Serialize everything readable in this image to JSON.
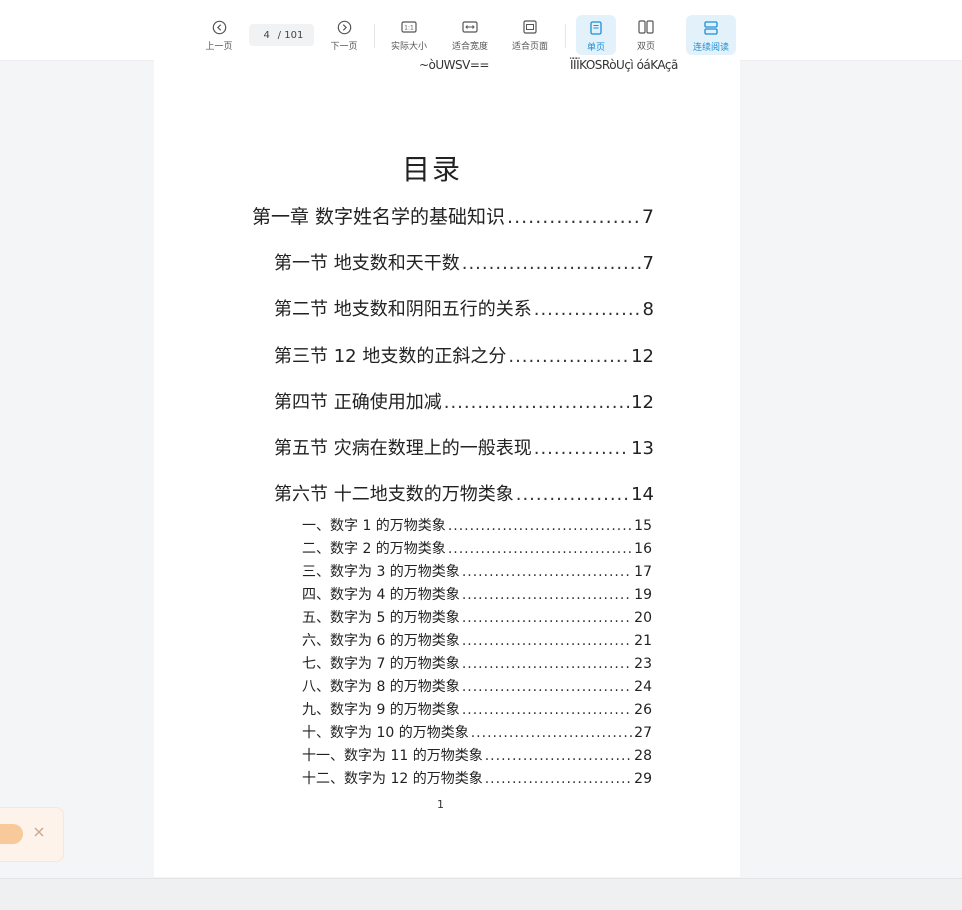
{
  "toolbar": {
    "prev_label": "上一页",
    "current_page": "4",
    "total_pages": "/ 101",
    "next_label": "下一页",
    "actual_size_label": "实际大小",
    "fit_width_label": "适合宽度",
    "fit_page_label": "适合页面",
    "single_page_label": "单页",
    "double_page_label": "双页",
    "continuous_label": "连续阅读",
    "accent_color": "#1a8fd6"
  },
  "document": {
    "header_left": "~òUWSV==",
    "header_right": "ÏÏÏKOSRòUçì óáKAçã",
    "toc_title": "目录",
    "chapters": [
      {
        "title": "第一章  数字姓名学的基础知识",
        "page": "7"
      }
    ],
    "sections": [
      {
        "title": "第一节  地支数和天干数",
        "page": "7"
      },
      {
        "title": "第二节  地支数和阴阳五行的关系",
        "page": "8"
      },
      {
        "title": "第三节  12 地支数的正斜之分",
        "page": "12"
      },
      {
        "title": "第四节  正确使用加减",
        "page": "12"
      },
      {
        "title": "第五节  灾病在数理上的一般表现",
        "page": "13"
      },
      {
        "title": "第六节  十二地支数的万物类象",
        "page": "14"
      }
    ],
    "items": [
      {
        "title": "一、数字 1 的万物类象",
        "page": "15"
      },
      {
        "title": "二、数字 2 的万物类象",
        "page": "16"
      },
      {
        "title": "三、数字为 3 的万物类象",
        "page": "17"
      },
      {
        "title": "四、数字为 4 的万物类象",
        "page": "19"
      },
      {
        "title": "五、数字为 5 的万物类象",
        "page": "20"
      },
      {
        "title": "六、数字为 6 的万物类象",
        "page": "21"
      },
      {
        "title": "七、数字为 7 的万物类象",
        "page": "23"
      },
      {
        "title": "八、数字为 8 的万物类象",
        "page": "24"
      },
      {
        "title": "九、数字为 9 的万物类象",
        "page": "26"
      },
      {
        "title": "十、数字为 10 的万物类象",
        "page": "27"
      },
      {
        "title": "十一、数字为 11 的万物类象",
        "page": "28"
      },
      {
        "title": "十二、数字为 12 的万物类象",
        "page": "29"
      }
    ],
    "footer_page_number": "1"
  },
  "toast": {
    "close_icon": "close-icon"
  }
}
